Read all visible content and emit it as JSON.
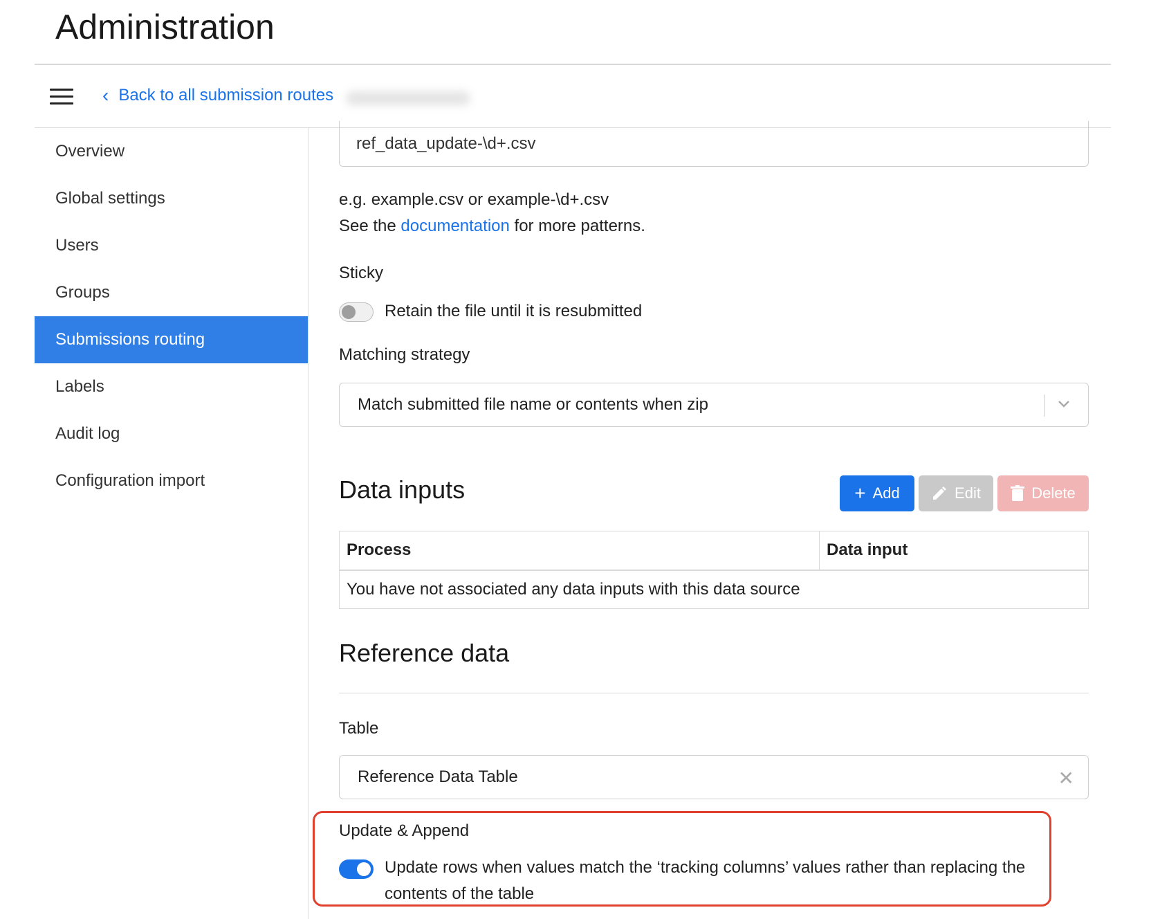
{
  "page_title": "Administration",
  "nav": {
    "back_label": "Back to all submission routes"
  },
  "sidebar": {
    "items": [
      {
        "label": "Overview",
        "active": false
      },
      {
        "label": "Global settings",
        "active": false
      },
      {
        "label": "Users",
        "active": false
      },
      {
        "label": "Groups",
        "active": false
      },
      {
        "label": "Submissions routing",
        "active": true
      },
      {
        "label": "Labels",
        "active": false
      },
      {
        "label": "Audit log",
        "active": false
      },
      {
        "label": "Configuration import",
        "active": false
      }
    ]
  },
  "pattern": {
    "value": "ref_data_update-\\d+.csv",
    "help_line1": "e.g. example.csv or example-\\d+.csv",
    "help_line2_prefix": "See the ",
    "help_link": "documentation",
    "help_line2_suffix": " for more patterns."
  },
  "sticky": {
    "label": "Sticky",
    "toggle_text": "Retain the file until it is resubmitted",
    "enabled": false
  },
  "matching": {
    "label": "Matching strategy",
    "selected": "Match submitted file name or contents when zip"
  },
  "data_inputs": {
    "title": "Data inputs",
    "buttons": {
      "add": "Add",
      "edit": "Edit",
      "delete": "Delete"
    },
    "columns": [
      "Process",
      "Data input"
    ],
    "empty_message": "You have not associated any data inputs with this data source"
  },
  "reference_data": {
    "title": "Reference data",
    "table_label": "Table",
    "table_value": "Reference Data Table",
    "update_label": "Update & Append",
    "update_toggle_text_line1": "Update rows when values match the ‘tracking columns’ values rather than replacing the",
    "update_toggle_text_line2": "contents of the table",
    "update_enabled": true
  },
  "colors": {
    "accent": "#1a73e8",
    "active_nav": "#2f7fe6",
    "highlight_border": "#e0412f",
    "delete_disabled": "#f2b5b5",
    "edit_disabled": "#c9c9c9"
  }
}
